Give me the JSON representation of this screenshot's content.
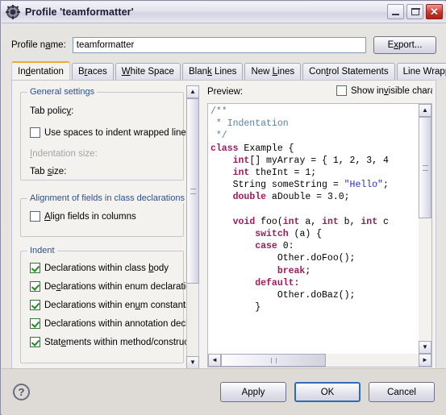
{
  "window": {
    "title": "Profile 'teamformatter'",
    "icon": "gear-icon",
    "minimize_label": "–",
    "maximize_label": "□",
    "close_label": "✕"
  },
  "profile_name": {
    "label": "Profile name:",
    "value": "teamformatter",
    "export_label": "Export..."
  },
  "tabs": [
    {
      "label": "Indentation",
      "active": true
    },
    {
      "label": "Braces",
      "active": false
    },
    {
      "label": "White Space",
      "active": false
    },
    {
      "label": "Blank Lines",
      "active": false
    },
    {
      "label": "New Lines",
      "active": false
    },
    {
      "label": "Control Statements",
      "active": false
    },
    {
      "label": "Line Wrapping",
      "active": false
    }
  ],
  "tab_scroll": {
    "prev": "◄",
    "next": "►"
  },
  "settings": {
    "general": {
      "title": "General settings",
      "tab_policy_label": "Tab policy:",
      "use_spaces_label": "Use spaces to indent wrapped lines",
      "use_spaces_checked": false,
      "indentation_size_label": "Indentation size:",
      "indentation_size_disabled": true,
      "tab_size_label": "Tab size:"
    },
    "alignment": {
      "title": "Alignment of fields in class declarations",
      "align_fields_label": "Align fields in columns",
      "align_fields_checked": false
    },
    "indent": {
      "title": "Indent",
      "items": [
        {
          "label": "Declarations within class body",
          "checked": true
        },
        {
          "label": "Declarations within enum declaration",
          "checked": true
        },
        {
          "label": "Declarations within enum constants",
          "checked": true
        },
        {
          "label": "Declarations within annotation declar",
          "checked": true
        },
        {
          "label": "Statements within method/constructo",
          "checked": true
        }
      ]
    }
  },
  "preview": {
    "label": "Preview:",
    "show_invisible_label": "Show invisible chara",
    "show_invisible_checked": false,
    "code_lines": [
      [
        {
          "t": "/**",
          "c": "cm"
        }
      ],
      [
        {
          "t": " * Indentation",
          "c": "cm"
        }
      ],
      [
        {
          "t": " */",
          "c": "cm"
        }
      ],
      [
        {
          "t": "class",
          "c": "kw"
        },
        {
          "t": " Example {",
          "c": ""
        }
      ],
      [
        {
          "t": "    ",
          "c": ""
        },
        {
          "t": "int",
          "c": "kw"
        },
        {
          "t": "[] myArray = { 1, 2, 3, 4",
          "c": ""
        }
      ],
      [
        {
          "t": "    ",
          "c": ""
        },
        {
          "t": "int",
          "c": "kw"
        },
        {
          "t": " theInt = 1;",
          "c": ""
        }
      ],
      [
        {
          "t": "    String someString = ",
          "c": ""
        },
        {
          "t": "\"Hello\"",
          "c": "st"
        },
        {
          "t": ";",
          "c": ""
        }
      ],
      [
        {
          "t": "    ",
          "c": ""
        },
        {
          "t": "double",
          "c": "kw"
        },
        {
          "t": " aDouble = 3.0;",
          "c": ""
        }
      ],
      [
        {
          "t": "",
          "c": ""
        }
      ],
      [
        {
          "t": "    ",
          "c": ""
        },
        {
          "t": "void",
          "c": "kw"
        },
        {
          "t": " foo(",
          "c": ""
        },
        {
          "t": "int",
          "c": "kw"
        },
        {
          "t": " a, ",
          "c": ""
        },
        {
          "t": "int",
          "c": "kw"
        },
        {
          "t": " b, ",
          "c": ""
        },
        {
          "t": "int",
          "c": "kw"
        },
        {
          "t": " c",
          "c": ""
        }
      ],
      [
        {
          "t": "        ",
          "c": ""
        },
        {
          "t": "switch",
          "c": "kw"
        },
        {
          "t": " (a) {",
          "c": ""
        }
      ],
      [
        {
          "t": "        ",
          "c": ""
        },
        {
          "t": "case",
          "c": "kw"
        },
        {
          "t": " 0:",
          "c": ""
        }
      ],
      [
        {
          "t": "            Other.doFoo();",
          "c": ""
        }
      ],
      [
        {
          "t": "            ",
          "c": ""
        },
        {
          "t": "break",
          "c": "kw"
        },
        {
          "t": ";",
          "c": ""
        }
      ],
      [
        {
          "t": "        ",
          "c": ""
        },
        {
          "t": "default",
          "c": "kw"
        },
        {
          "t": ":",
          "c": ""
        }
      ],
      [
        {
          "t": "            Other.doBaz();",
          "c": ""
        }
      ],
      [
        {
          "t": "        }",
          "c": ""
        }
      ]
    ]
  },
  "scrollbars": {
    "up": "▲",
    "down": "▼",
    "left": "◄",
    "right": "►"
  },
  "footer": {
    "help_label": "?",
    "apply_label": "Apply",
    "ok_label": "OK",
    "cancel_label": "Cancel"
  }
}
